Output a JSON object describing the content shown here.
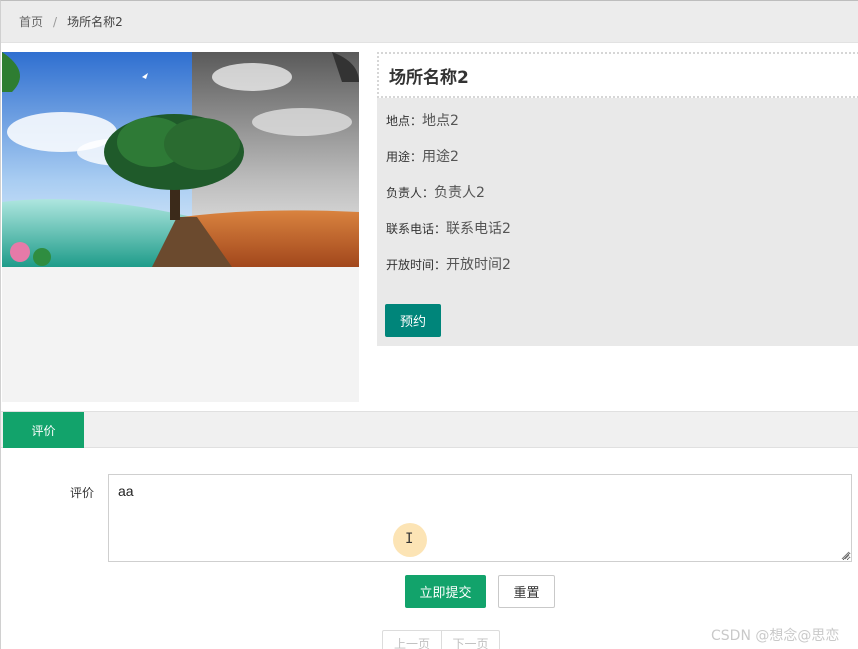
{
  "breadcrumb": {
    "home": "首页",
    "separator": "/",
    "current": "场所名称2"
  },
  "venue": {
    "title": "场所名称2",
    "fields": [
      {
        "label": "地点：",
        "value": "地点2"
      },
      {
        "label": "用途：",
        "value": "用途2"
      },
      {
        "label": "负责人：",
        "value": "负责人2"
      },
      {
        "label": "联系电话：",
        "value": "联系电话2"
      },
      {
        "label": "开放时间：",
        "value": "开放时间2"
      }
    ],
    "book_label": "预约"
  },
  "tabs": {
    "active_label": "评价"
  },
  "review_form": {
    "label": "评价",
    "value": "aa",
    "submit_label": "立即提交",
    "reset_label": "重置"
  },
  "pagination": {
    "prev_label": "上一页",
    "next_label": "下一页"
  },
  "watermark": "CSDN @想念@思恋",
  "colors": {
    "primary_green": "#12a36b",
    "teal_button": "#00857a",
    "panel_gray": "#e9e9e9"
  }
}
